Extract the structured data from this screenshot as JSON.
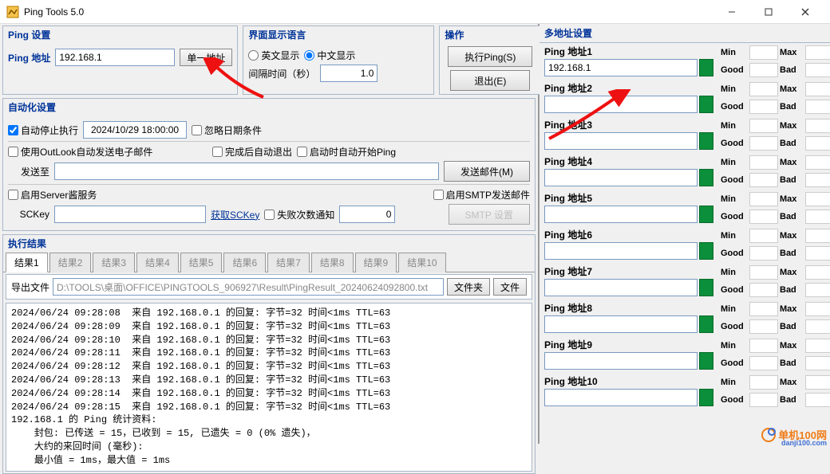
{
  "titlebar": {
    "title": "Ping Tools 5.0"
  },
  "ping_settings": {
    "section_title": "Ping 设置",
    "addr_label": "Ping 地址",
    "addr_value": "192.168.1",
    "single_btn": "单一地址",
    "interval_label": "间隔时间（秒）",
    "interval_value": "1.0"
  },
  "lang": {
    "section_title": "界面显示语言",
    "en": "英文显示",
    "cn": "中文显示",
    "selected": "cn"
  },
  "ops": {
    "section_title": "操作",
    "run": "执行Ping(S)",
    "exit": "退出(E)"
  },
  "auto": {
    "section_title": "自动化设置",
    "auto_stop": "自动停止执行",
    "auto_stop_time": "2024/10/29 18:00:00",
    "ignore_date": "忽略日期条件",
    "use_outlook": "使用OutLook自动发送电子邮件",
    "auto_exit": "完成后自动退出",
    "auto_start": "启动时自动开始Ping",
    "send_to_label": "发送至",
    "send_mail_btn": "发送邮件(M)",
    "enable_serverchan": "启用Server酱服务",
    "sckey_label": "SCKey",
    "get_sckey": "获取SCKey",
    "fail_notify": "失败次数通知",
    "fail_count": "0",
    "enable_smtp": "启用SMTP发送邮件",
    "smtp_settings_btn": "SMTP 设置"
  },
  "results": {
    "section_title": "执行结果",
    "tabs": [
      "结果1",
      "结果2",
      "结果3",
      "结果4",
      "结果5",
      "结果6",
      "结果7",
      "结果8",
      "结果9",
      "结果10"
    ],
    "active_tab": 0,
    "export_label": "导出文件",
    "export_path": "D:\\TOOLS\\桌面\\OFFICE\\PINGTOOLS_906927\\Result\\PingResult_20240624092800.txt",
    "folder_btn": "文件夹",
    "file_btn": "文件",
    "log_lines": [
      "2024/06/24 09:28:08  来自 192.168.0.1 的回复: 字节=32 时间<1ms TTL=63",
      "2024/06/24 09:28:09  来自 192.168.0.1 的回复: 字节=32 时间<1ms TTL=63",
      "2024/06/24 09:28:10  来自 192.168.0.1 的回复: 字节=32 时间<1ms TTL=63",
      "2024/06/24 09:28:11  来自 192.168.0.1 的回复: 字节=32 时间<1ms TTL=63",
      "2024/06/24 09:28:12  来自 192.168.0.1 的回复: 字节=32 时间<1ms TTL=63",
      "2024/06/24 09:28:13  来自 192.168.0.1 的回复: 字节=32 时间<1ms TTL=63",
      "2024/06/24 09:28:14  来自 192.168.0.1 的回复: 字节=32 时间<1ms TTL=63",
      "2024/06/24 09:28:15  来自 192.168.0.1 的回复: 字节=32 时间<1ms TTL=63",
      "192.168.1 的 Ping 统计资料:",
      "    封包: 已传送 = 15，已收到 = 15, 已遗失 = 0 (0% 遗失)，",
      "    大约的来回时间 (毫秒):",
      "    最小值 = 1ms，最大值 = 1ms"
    ]
  },
  "multi": {
    "section_title": "多地址设置",
    "labels": {
      "min": "Min",
      "max": "Max",
      "good": "Good",
      "bad": "Bad"
    },
    "rows": [
      {
        "label": "Ping 地址1",
        "value": "192.168.1"
      },
      {
        "label": "Ping 地址2",
        "value": ""
      },
      {
        "label": "Ping 地址3",
        "value": ""
      },
      {
        "label": "Ping 地址4",
        "value": ""
      },
      {
        "label": "Ping 地址5",
        "value": ""
      },
      {
        "label": "Ping 地址6",
        "value": ""
      },
      {
        "label": "Ping 地址7",
        "value": ""
      },
      {
        "label": "Ping 地址8",
        "value": ""
      },
      {
        "label": "Ping 地址9",
        "value": ""
      },
      {
        "label": "Ping 地址10",
        "value": ""
      }
    ]
  },
  "watermark": "单机100网"
}
